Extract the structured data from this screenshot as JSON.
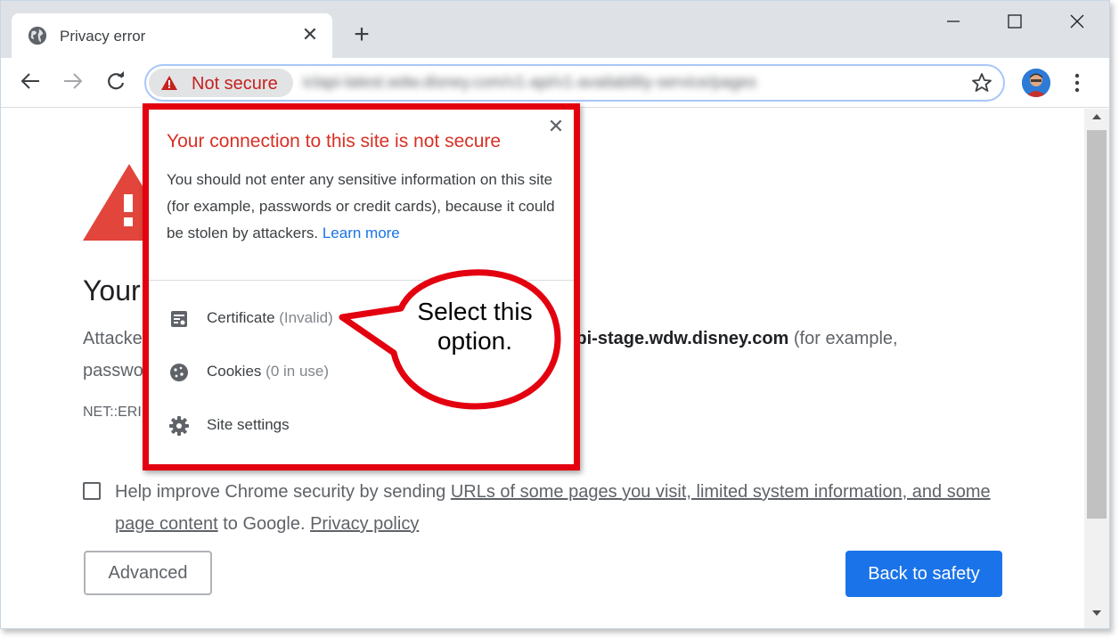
{
  "tab": {
    "title": "Privacy error",
    "icon": "globe-icon"
  },
  "address_bar": {
    "security_label": "Not secure",
    "url": "iclapi-latest.wdw.disney.com/v1-api/v1-availability-service/pages"
  },
  "page": {
    "heading": "Your",
    "body_prefix": "Attacke",
    "body_domain": "lapi-stage.wdw.disney.com",
    "body_suffix": " (for example,",
    "body_line2": "passwo",
    "error_code": "NET::ERI",
    "help_text_prefix": "Help improve Chrome security by sending ",
    "help_link": "URLs of some pages you visit, limited system information, and some page content",
    "help_text_mid": " to Google. ",
    "privacy_link": "Privacy policy",
    "advanced_label": "Advanced",
    "back_label": "Back to safety"
  },
  "popup": {
    "title": "Your connection to this site is not secure",
    "body": "You should not enter any sensitive information on this site (for example, passwords or credit cards), because it could be stolen by attackers.",
    "learn_more": "Learn more",
    "items": [
      {
        "label": "Certificate",
        "sub": "(Invalid)",
        "icon": "certificate-icon"
      },
      {
        "label": "Cookies",
        "sub": "(0 in use)",
        "icon": "cookie-icon"
      },
      {
        "label": "Site settings",
        "sub": "",
        "icon": "gear-icon"
      }
    ]
  },
  "callout": {
    "text": "Select this option."
  },
  "colors": {
    "accent_blue": "#1a73e8",
    "danger_red": "#d93025",
    "highlight_red": "#e3000f"
  }
}
